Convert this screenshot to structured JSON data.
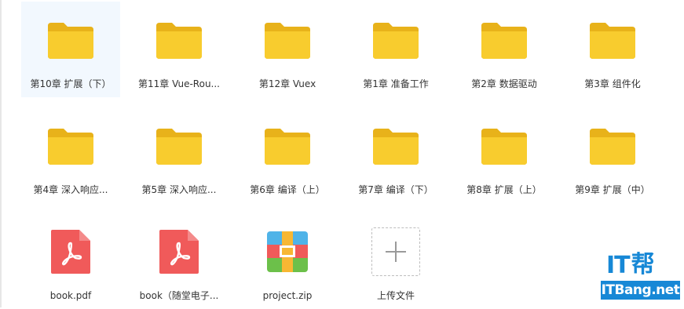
{
  "items": [
    {
      "type": "folder",
      "name": "第10章 扩展（下）",
      "selected": true
    },
    {
      "type": "folder",
      "name": "第11章 Vue-Rou..."
    },
    {
      "type": "folder",
      "name": "第12章 Vuex"
    },
    {
      "type": "folder",
      "name": "第1章 准备工作"
    },
    {
      "type": "folder",
      "name": "第2章 数据驱动"
    },
    {
      "type": "folder",
      "name": "第3章 组件化"
    },
    {
      "type": "folder",
      "name": "第4章 深入响应..."
    },
    {
      "type": "folder",
      "name": "第5章 深入响应..."
    },
    {
      "type": "folder",
      "name": "第6章 编译（上）"
    },
    {
      "type": "folder",
      "name": "第7章 编译（下）"
    },
    {
      "type": "folder",
      "name": "第8章 扩展（上）"
    },
    {
      "type": "folder",
      "name": "第9章 扩展（中）"
    },
    {
      "type": "pdf",
      "name": "book.pdf"
    },
    {
      "type": "pdf",
      "name": "book（随堂电子..."
    },
    {
      "type": "zip",
      "name": "project.zip"
    },
    {
      "type": "upload",
      "name": "上传文件"
    }
  ],
  "colors": {
    "folder_back": "#e8b21a",
    "folder_front": "#f8cc2e",
    "pdf": "#f05a5a",
    "selection": "#f2f8fe",
    "brand": "#1788d6"
  },
  "watermark": {
    "logo_top_latin": "IT",
    "logo_top_cjk": "帮",
    "logo_bottom": "ITBang.net"
  }
}
